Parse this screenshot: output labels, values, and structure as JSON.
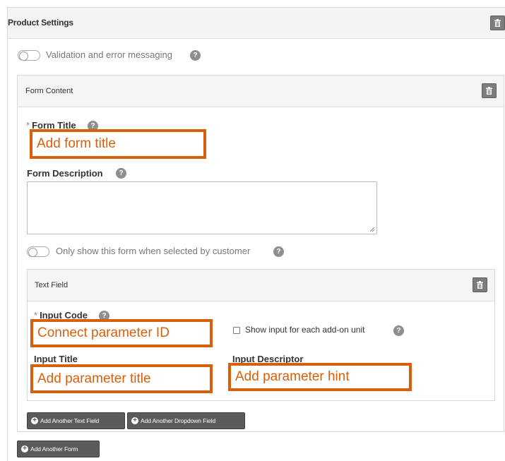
{
  "product_settings": {
    "title": "Product Settings",
    "delete_icon": "trash-icon",
    "validation_toggle": {
      "label": "Validation and error messaging",
      "on": false,
      "help": "?"
    }
  },
  "form_content": {
    "title": "Form Content",
    "delete_icon": "trash-icon",
    "form_title": {
      "required_mark": "*",
      "label": "Form Title",
      "help": "?",
      "value": "Add form title"
    },
    "form_description": {
      "label": "Form Description",
      "help": "?",
      "value": ""
    },
    "only_show_toggle": {
      "label": "Only show this form when selected by customer",
      "on": false,
      "help": "?"
    },
    "text_field": {
      "title": "Text Field",
      "delete_icon": "trash-icon",
      "input_code": {
        "required_mark": "*",
        "label": "Input Code",
        "help": "?",
        "value": "Connect parameter ID"
      },
      "show_input_checkbox": {
        "label": "Show input for each add-on unit",
        "checked": false,
        "help": "?"
      },
      "input_title": {
        "label": "Input Title",
        "value": "Add parameter title"
      },
      "input_descriptor": {
        "label": "Input Descriptor",
        "value": "Add parameter hint"
      }
    },
    "buttons": {
      "add_text_field": "Add Another Text Field",
      "add_dropdown_field": "Add Another Dropdown Field"
    }
  },
  "add_form_button": "Add Another Form",
  "colors": {
    "highlight": "#d8600c",
    "button_dark": "#5b5b5b",
    "panel_header_bg": "#f5f5f5",
    "border": "#d9d9d9"
  }
}
